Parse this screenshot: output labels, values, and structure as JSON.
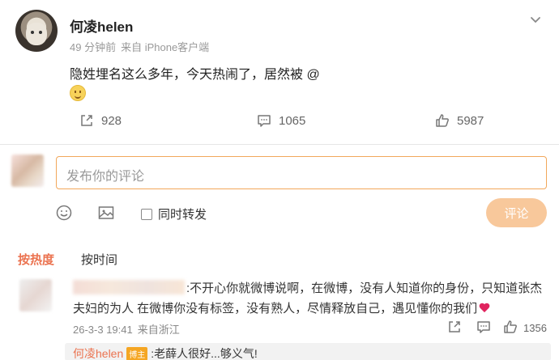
{
  "post": {
    "author": "何凌helen",
    "time": "49 分钟前",
    "source": "来自 iPhone客户端",
    "text": "隐姓埋名这么多年，今天热闹了，居然被 @",
    "stats": {
      "shares": "928",
      "comments": "1065",
      "likes": "5987"
    }
  },
  "composer": {
    "placeholder": "发布你的评论",
    "repost_label": "同时转发",
    "submit_label": "评论"
  },
  "sort_tabs": {
    "hot": "按热度",
    "time": "按时间"
  },
  "comments": [
    {
      "text": ":不开心你就微博说啊，在微博，没有人知道你的身份，只知道张杰夫妇的为人  在微博你没有标签，没有熟人，尽情释放自己，遇见懂你的我们",
      "time": "26-3-3 19:41",
      "location": "来自浙江",
      "likes": "1356",
      "reply": {
        "author": "何凌helen",
        "badge": "博主",
        "text": ":老薛人很好...够义气!"
      }
    }
  ],
  "colors": {
    "accent": "#eb7350",
    "input_border": "#f2a85b",
    "button_bg": "#f8c89b"
  },
  "icons": {
    "more": "chevron-down-icon",
    "share": "share-icon",
    "comment": "comment-icon",
    "like": "thumbs-up-icon",
    "emoji": "smiley-icon",
    "image": "image-icon"
  }
}
